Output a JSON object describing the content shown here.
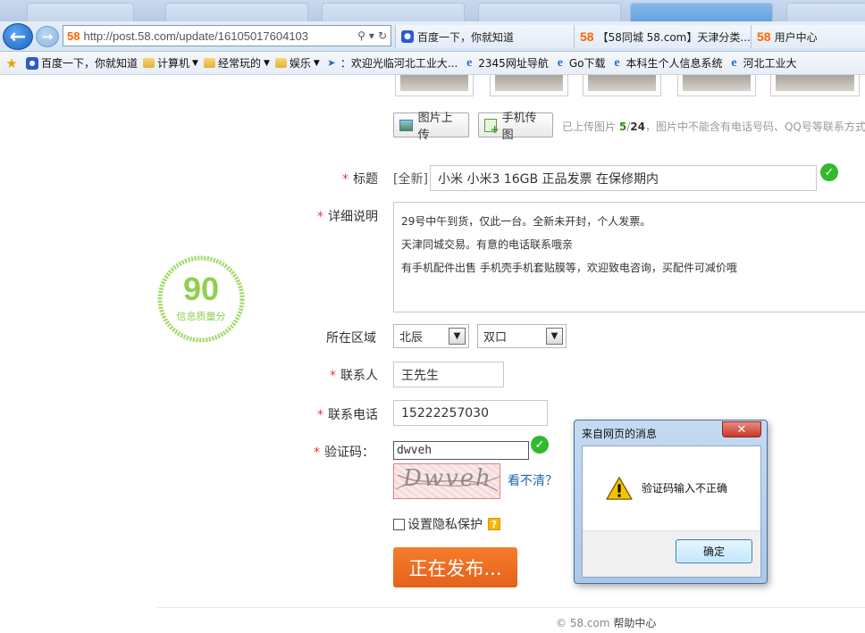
{
  "browser": {
    "address_logo": "58",
    "address_url": "http://post.58.com/update/16105017604103",
    "open_tabs": [
      {
        "icon": "baidu-paw-icon",
        "label": "百度一下，你就知道"
      },
      {
        "icon": "58-logo-icon",
        "label": "【58同城 58.com】天津分类..."
      },
      {
        "icon": "58-logo-icon",
        "label": "用户中心"
      }
    ],
    "favorites": [
      {
        "icon": "favorites-star-icon",
        "label": ""
      },
      {
        "icon": "baidu-paw-icon",
        "label": "百度一下，你就知道"
      },
      {
        "icon": "folder-icon",
        "label": "计算机",
        "dropdown": true
      },
      {
        "icon": "folder-icon",
        "label": "经常玩的",
        "dropdown": true
      },
      {
        "icon": "folder-icon",
        "label": "娱乐",
        "dropdown": true
      },
      {
        "icon": "bird-icon",
        "label": "：欢迎光临河北工业大..."
      },
      {
        "icon": "ie-page-icon",
        "label": "2345网址导航"
      },
      {
        "icon": "ie-page-icon",
        "label": "Go下载"
      },
      {
        "icon": "ie-page-icon",
        "label": "本科生个人信息系统"
      },
      {
        "icon": "ie-page-icon",
        "label": "河北工业大"
      }
    ]
  },
  "upload": {
    "upload_btn": "图片上传",
    "phone_btn": "手机传图",
    "hint_prefix": "已上传图片",
    "uploaded": "5",
    "sep": "/",
    "total": "24",
    "hint_suffix": "，图片中不能含有电话号码、QQ号等联系方式"
  },
  "form": {
    "title_label": "标题",
    "title_prefix": "[全新]",
    "title_value": "小米 小米3 16GB 正品发票 在保修期内",
    "desc_label": "详细说明",
    "desc_lines": [
      "29号中午到货，仅此一台。全新未开封，个人发票。",
      "天津同城交易。有意的电话联系哦亲",
      "有手机配件出售  手机壳手机套贴膜等，欢迎致电咨询，买配件可减价哦"
    ],
    "area_label": "所在区域",
    "area_district": "北辰",
    "area_sub": "双口",
    "contact_label": "联系人",
    "contact_value": "王先生",
    "phone_label": "联系电话",
    "phone_value": "15222257030",
    "captcha_label": "验证码：",
    "captcha_value": "dwveh",
    "captcha_image_text": "Dwveh",
    "captcha_refresh": "看不清？",
    "privacy_label": "设置隐私保护",
    "publish_btn": "正在发布..."
  },
  "quality": {
    "score": "90",
    "label": "信息质量分",
    "ring_color": "#a6d86a"
  },
  "footer": {
    "copyright": "© 58.com",
    "help": "帮助中心"
  },
  "dialog": {
    "title": "来自网页的消息",
    "close": "✕",
    "message": "验证码输入不正确",
    "ok": "确定"
  }
}
